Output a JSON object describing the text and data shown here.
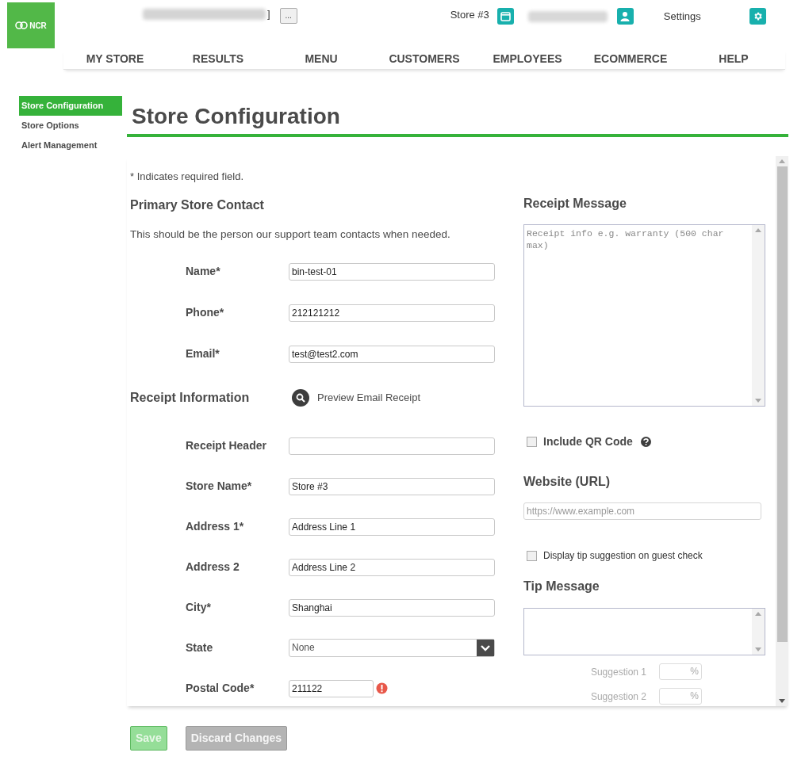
{
  "header": {
    "logo": "NCR",
    "store_selector_tail": "]",
    "more_button": "...",
    "store": "Store #3",
    "settings": "Settings"
  },
  "nav": [
    "MY STORE",
    "RESULTS",
    "MENU",
    "CUSTOMERS",
    "EMPLOYEES",
    "ECOMMERCE",
    "HELP"
  ],
  "sidebar": [
    {
      "label": "Store Configuration",
      "selected": true
    },
    {
      "label": "Store Options",
      "selected": false
    },
    {
      "label": "Alert Management",
      "selected": false
    }
  ],
  "page_title": "Store Configuration",
  "required_note": "* Indicates required field.",
  "primary_contact": {
    "heading": "Primary Store Contact",
    "description": "This should be the person our support team contacts when needed.",
    "fields": [
      {
        "label": "Name*",
        "value": "bin-test-01",
        "kind": "text",
        "error": false
      },
      {
        "label": "Phone*",
        "value": "212121212",
        "kind": "text",
        "error": false
      },
      {
        "label": "Email*",
        "value": "test@test2.com",
        "kind": "text",
        "error": false
      }
    ]
  },
  "receipt_information": {
    "heading": "Receipt Information",
    "preview_link": "Preview Email Receipt",
    "fields": [
      {
        "label": "Receipt Header",
        "kind": "text",
        "error": false
      },
      {
        "label": "Store Name*",
        "value": "Store #3",
        "kind": "text",
        "error": false
      },
      {
        "label": "Address 1*",
        "value": "Address Line 1",
        "kind": "text",
        "error": false
      },
      {
        "label": "Address 2",
        "value": "Address Line 2",
        "kind": "text",
        "error": false
      },
      {
        "label": "City*",
        "value": "Shanghai",
        "kind": "text",
        "error": false
      },
      {
        "label": "State",
        "value": "None",
        "kind": "select",
        "error": false
      },
      {
        "label": "Postal Code*",
        "value": "211122",
        "kind": "short",
        "error": true
      }
    ]
  },
  "receipt_message": {
    "heading": "Receipt Message",
    "placeholder": "Receipt info e.g. warranty (500 char max)"
  },
  "include_qr": {
    "label": "Include QR Code",
    "checked": false
  },
  "website": {
    "heading": "Website (URL)",
    "placeholder": "https://www.example.com"
  },
  "tip_suggestion": {
    "label": "Display tip suggestion on guest check",
    "checked": false
  },
  "tip_message": {
    "heading": "Tip Message"
  },
  "suggestions": [
    {
      "label": "Suggestion 1",
      "unit": "%"
    },
    {
      "label": "Suggestion 2",
      "unit": "%"
    }
  ],
  "buttons": [
    {
      "label": "Save",
      "kind": "primary",
      "disabled": true
    },
    {
      "label": "Discard Changes",
      "kind": "secondary",
      "disabled": true
    }
  ]
}
